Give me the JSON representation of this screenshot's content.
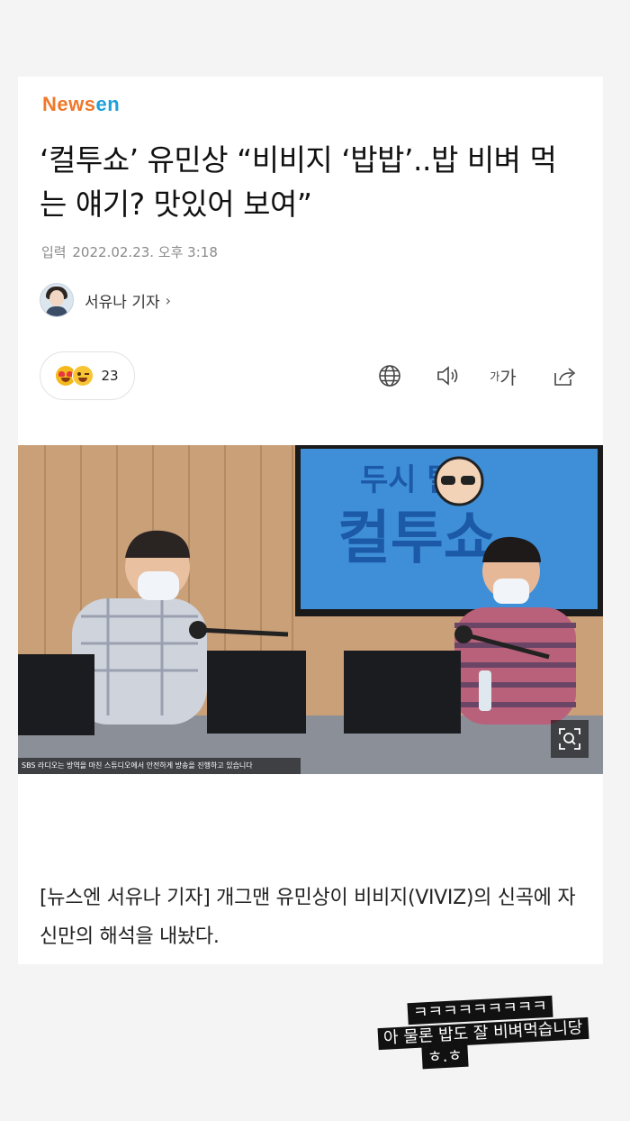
{
  "brand": {
    "logo_n": "N",
    "logo_ews": "ews",
    "logo_en": "en"
  },
  "article": {
    "title": "‘컬투쇼’ 유민상 “비비지 ‘밥밥’..밥 비벼 먹는 얘기? 맛있어 보여”",
    "date_label": "입력",
    "date_value": "2022.02.23. 오후 3:18",
    "reporter": "서유나 기자",
    "reporter_chevron": "›",
    "reaction_count": "23",
    "font_size_small": "가",
    "font_size_large": "가",
    "photo_caption": "SBS 라디오는 방역을 마친 스튜디오에서 안전하게 방송을 진행하고 있습니다",
    "photo_screen_text_top": "두시 탈출",
    "photo_screen_text_main": "컬투쇼",
    "body": "[뉴스엔 서유나 기자] 개그맨 유민상이 비비지(VIVIZ)의 신곡에 자신만의 해석을 내놨다."
  },
  "stickers": {
    "line1": "ㅋㅋㅋㅋㅋㅋㅋㅋㅋ",
    "line2": "아 물론 밥도 잘 비벼먹습니당",
    "line3": "ㅎ.ㅎ"
  },
  "colors": {
    "brand_orange": "#f0782a",
    "brand_blue": "#1da1d8",
    "screen_blue": "#3f8fd8"
  },
  "icons": [
    "globe-icon",
    "speaker-icon",
    "font-size-icon",
    "share-icon",
    "zoom-icon",
    "chevron-right-icon"
  ]
}
